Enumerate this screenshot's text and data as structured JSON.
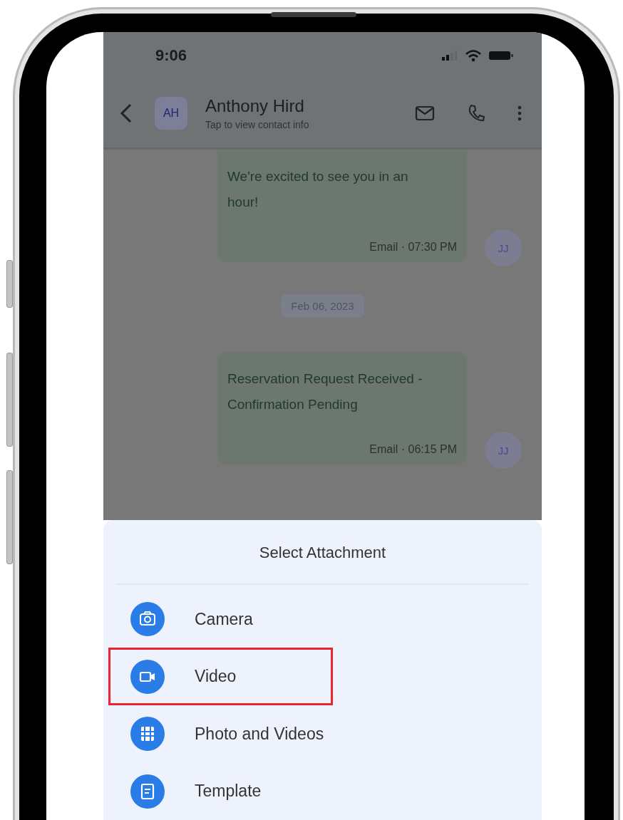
{
  "status_bar": {
    "time": "9:06"
  },
  "header": {
    "avatar": "AH",
    "name": "Anthony Hird",
    "subtitle": "Tap to view contact info"
  },
  "messages": [
    {
      "kind": "bubble",
      "text": "We're excited to see you in an hour!",
      "meta": "Email · 07:30 PM",
      "avatar": "JJ"
    },
    {
      "kind": "date",
      "text": "Feb 06, 2023"
    },
    {
      "kind": "bubble",
      "text": "Reservation Request Received - Confirmation Pending",
      "meta": "Email · 06:15 PM",
      "avatar": "JJ"
    }
  ],
  "sheet": {
    "title": "Select Attachment",
    "items": [
      {
        "label": "Camera",
        "highlighted": false
      },
      {
        "label": "Video",
        "highlighted": true
      },
      {
        "label": "Photo and Videos",
        "highlighted": false
      },
      {
        "label": "Template",
        "highlighted": false
      }
    ]
  }
}
